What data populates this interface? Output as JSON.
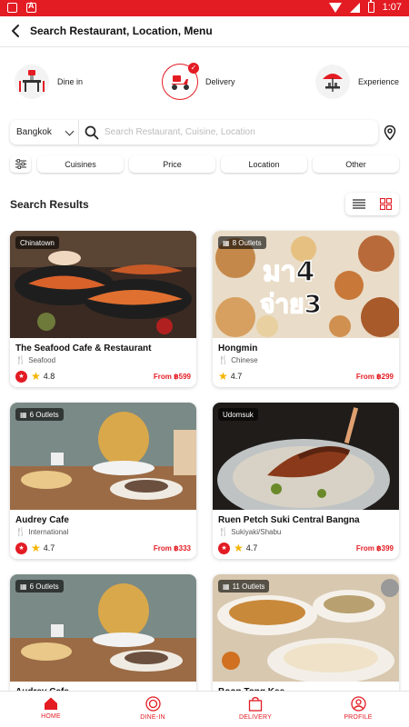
{
  "status_bar": {
    "time": "1:07"
  },
  "header": {
    "title": "Search Restaurant, Location, Menu"
  },
  "categories": [
    {
      "label": "Dine in",
      "active": false
    },
    {
      "label": "Delivery",
      "active": true
    },
    {
      "label": "Experience",
      "active": false
    }
  ],
  "search": {
    "city": "Bangkok",
    "placeholder": "Search Restaurant, Cuisine, Location"
  },
  "filters": [
    "Cuisines",
    "Price",
    "Location",
    "Other"
  ],
  "results": {
    "title": "Search Results",
    "cards": [
      {
        "tag": "Chinatown",
        "name": "The Seafood Cafe & Restaurant",
        "cuisine": "Seafood",
        "rating": "4.8",
        "price": "From ฿599"
      },
      {
        "tag": "8 Outlets",
        "name": "Hongmin",
        "cuisine": "Chinese",
        "rating": "4.7",
        "price": "From ฿299"
      },
      {
        "tag": "6 Outlets",
        "name": "Audrey Cafe",
        "cuisine": "International",
        "rating": "4.7",
        "price": "From ฿333"
      },
      {
        "tag": "Udomsuk",
        "name": "Ruen Petch Suki Central Bangna",
        "cuisine": "Sukiyaki/Shabu",
        "rating": "4.7",
        "price": "From ฿399"
      },
      {
        "tag": "6 Outlets",
        "name": "Audrey Cafe",
        "cuisine": "",
        "rating": "",
        "price": ""
      },
      {
        "tag": "11 Outlets",
        "name": "Boon Tong Kee",
        "cuisine": "",
        "rating": "",
        "price": ""
      }
    ],
    "promo_text": {
      "line1": "มา4",
      "line2": "จ่าย3"
    }
  },
  "bottom_nav": [
    {
      "label": "HOME",
      "icon": "home-icon"
    },
    {
      "label": "DINE-IN",
      "icon": "dine-in-icon"
    },
    {
      "label": "DELIVERY",
      "icon": "bag-icon"
    },
    {
      "label": "PROFILE",
      "icon": "profile-icon"
    }
  ],
  "colors": {
    "accent": "#e31b23",
    "star": "#f5b400"
  }
}
